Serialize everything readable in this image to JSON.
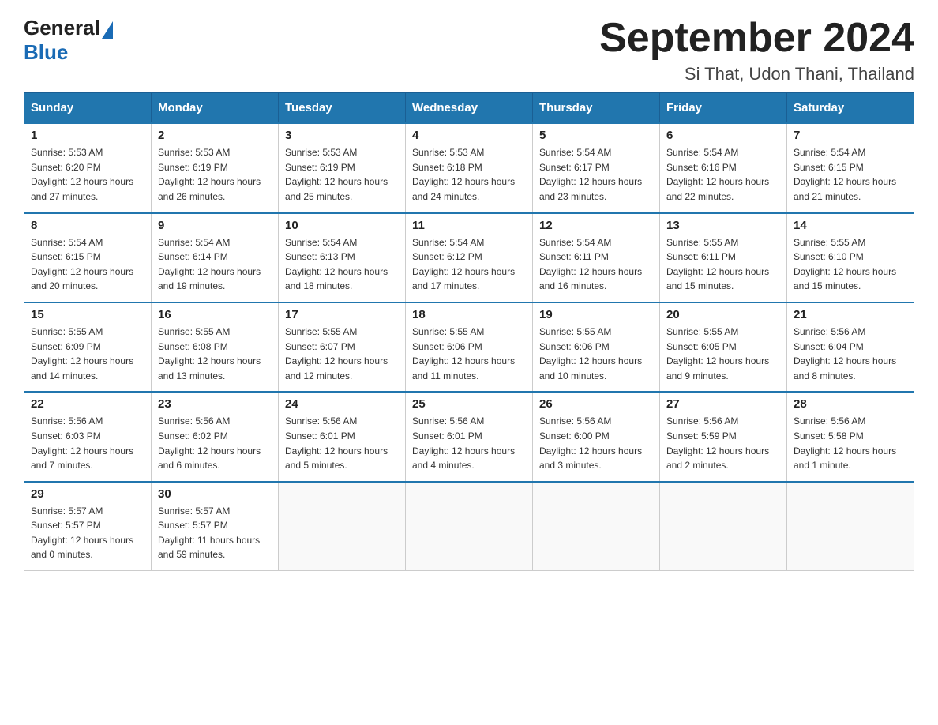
{
  "logo": {
    "text_general": "General",
    "text_blue": "Blue",
    "triangle": true
  },
  "header": {
    "month_title": "September 2024",
    "location": "Si That, Udon Thani, Thailand"
  },
  "weekdays": [
    "Sunday",
    "Monday",
    "Tuesday",
    "Wednesday",
    "Thursday",
    "Friday",
    "Saturday"
  ],
  "weeks": [
    [
      {
        "day": "1",
        "sunrise": "5:53 AM",
        "sunset": "6:20 PM",
        "daylight": "12 hours and 27 minutes."
      },
      {
        "day": "2",
        "sunrise": "5:53 AM",
        "sunset": "6:19 PM",
        "daylight": "12 hours and 26 minutes."
      },
      {
        "day": "3",
        "sunrise": "5:53 AM",
        "sunset": "6:19 PM",
        "daylight": "12 hours and 25 minutes."
      },
      {
        "day": "4",
        "sunrise": "5:53 AM",
        "sunset": "6:18 PM",
        "daylight": "12 hours and 24 minutes."
      },
      {
        "day": "5",
        "sunrise": "5:54 AM",
        "sunset": "6:17 PM",
        "daylight": "12 hours and 23 minutes."
      },
      {
        "day": "6",
        "sunrise": "5:54 AM",
        "sunset": "6:16 PM",
        "daylight": "12 hours and 22 minutes."
      },
      {
        "day": "7",
        "sunrise": "5:54 AM",
        "sunset": "6:15 PM",
        "daylight": "12 hours and 21 minutes."
      }
    ],
    [
      {
        "day": "8",
        "sunrise": "5:54 AM",
        "sunset": "6:15 PM",
        "daylight": "12 hours and 20 minutes."
      },
      {
        "day": "9",
        "sunrise": "5:54 AM",
        "sunset": "6:14 PM",
        "daylight": "12 hours and 19 minutes."
      },
      {
        "day": "10",
        "sunrise": "5:54 AM",
        "sunset": "6:13 PM",
        "daylight": "12 hours and 18 minutes."
      },
      {
        "day": "11",
        "sunrise": "5:54 AM",
        "sunset": "6:12 PM",
        "daylight": "12 hours and 17 minutes."
      },
      {
        "day": "12",
        "sunrise": "5:54 AM",
        "sunset": "6:11 PM",
        "daylight": "12 hours and 16 minutes."
      },
      {
        "day": "13",
        "sunrise": "5:55 AM",
        "sunset": "6:11 PM",
        "daylight": "12 hours and 15 minutes."
      },
      {
        "day": "14",
        "sunrise": "5:55 AM",
        "sunset": "6:10 PM",
        "daylight": "12 hours and 15 minutes."
      }
    ],
    [
      {
        "day": "15",
        "sunrise": "5:55 AM",
        "sunset": "6:09 PM",
        "daylight": "12 hours and 14 minutes."
      },
      {
        "day": "16",
        "sunrise": "5:55 AM",
        "sunset": "6:08 PM",
        "daylight": "12 hours and 13 minutes."
      },
      {
        "day": "17",
        "sunrise": "5:55 AM",
        "sunset": "6:07 PM",
        "daylight": "12 hours and 12 minutes."
      },
      {
        "day": "18",
        "sunrise": "5:55 AM",
        "sunset": "6:06 PM",
        "daylight": "12 hours and 11 minutes."
      },
      {
        "day": "19",
        "sunrise": "5:55 AM",
        "sunset": "6:06 PM",
        "daylight": "12 hours and 10 minutes."
      },
      {
        "day": "20",
        "sunrise": "5:55 AM",
        "sunset": "6:05 PM",
        "daylight": "12 hours and 9 minutes."
      },
      {
        "day": "21",
        "sunrise": "5:56 AM",
        "sunset": "6:04 PM",
        "daylight": "12 hours and 8 minutes."
      }
    ],
    [
      {
        "day": "22",
        "sunrise": "5:56 AM",
        "sunset": "6:03 PM",
        "daylight": "12 hours and 7 minutes."
      },
      {
        "day": "23",
        "sunrise": "5:56 AM",
        "sunset": "6:02 PM",
        "daylight": "12 hours and 6 minutes."
      },
      {
        "day": "24",
        "sunrise": "5:56 AM",
        "sunset": "6:01 PM",
        "daylight": "12 hours and 5 minutes."
      },
      {
        "day": "25",
        "sunrise": "5:56 AM",
        "sunset": "6:01 PM",
        "daylight": "12 hours and 4 minutes."
      },
      {
        "day": "26",
        "sunrise": "5:56 AM",
        "sunset": "6:00 PM",
        "daylight": "12 hours and 3 minutes."
      },
      {
        "day": "27",
        "sunrise": "5:56 AM",
        "sunset": "5:59 PM",
        "daylight": "12 hours and 2 minutes."
      },
      {
        "day": "28",
        "sunrise": "5:56 AM",
        "sunset": "5:58 PM",
        "daylight": "12 hours and 1 minute."
      }
    ],
    [
      {
        "day": "29",
        "sunrise": "5:57 AM",
        "sunset": "5:57 PM",
        "daylight": "12 hours and 0 minutes."
      },
      {
        "day": "30",
        "sunrise": "5:57 AM",
        "sunset": "5:57 PM",
        "daylight": "11 hours and 59 minutes."
      },
      null,
      null,
      null,
      null,
      null
    ]
  ],
  "labels": {
    "sunrise": "Sunrise:",
    "sunset": "Sunset:",
    "daylight": "Daylight:"
  }
}
